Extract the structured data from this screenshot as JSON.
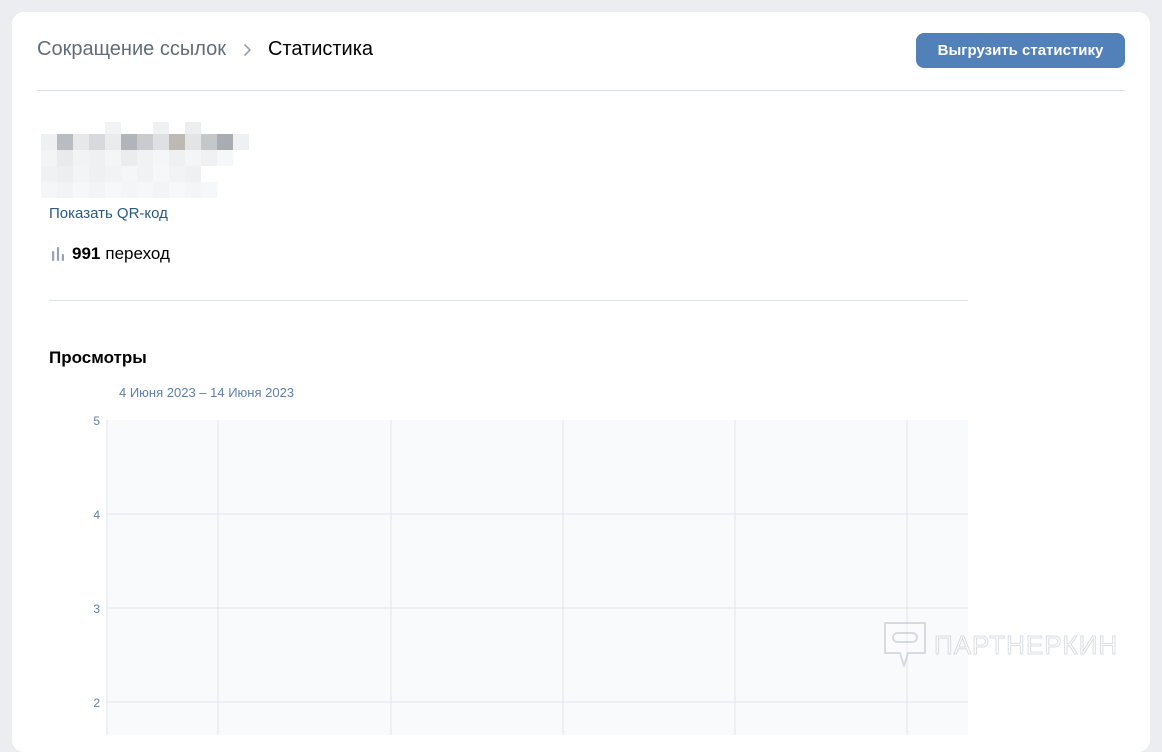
{
  "breadcrumb": {
    "parent": "Сокращение ссылок",
    "current": "Статистика"
  },
  "header": {
    "export_label": "Выгрузить статистику"
  },
  "link": {
    "qr_label": "Показать QR-код",
    "transitions_count": "991",
    "transitions_label": "переход"
  },
  "views": {
    "title": "Просмотры",
    "date_range": "4 Июня 2023 – 14 Июня 2023"
  },
  "chart_data": {
    "type": "line",
    "title": "",
    "xlabel": "",
    "ylabel": "",
    "y_ticks": [
      "5",
      "4",
      "3",
      "2"
    ],
    "ylim": [
      2,
      5
    ],
    "grid": true,
    "series": [],
    "colors": {
      "plot_background": "#f9fafc",
      "grid": "#dfe4ea",
      "tick_label": "#5e81a8"
    }
  },
  "watermark": {
    "text": "ПАРТНЕРКИН",
    "icon": "chat-bubble-icon"
  },
  "colors": {
    "accent": "#5181b8",
    "link": "#2a5885",
    "page_background": "#ebedf0"
  },
  "icons": {
    "breadcrumb_separator": "chevron-right-icon",
    "stats": "bar-chart-icon"
  }
}
